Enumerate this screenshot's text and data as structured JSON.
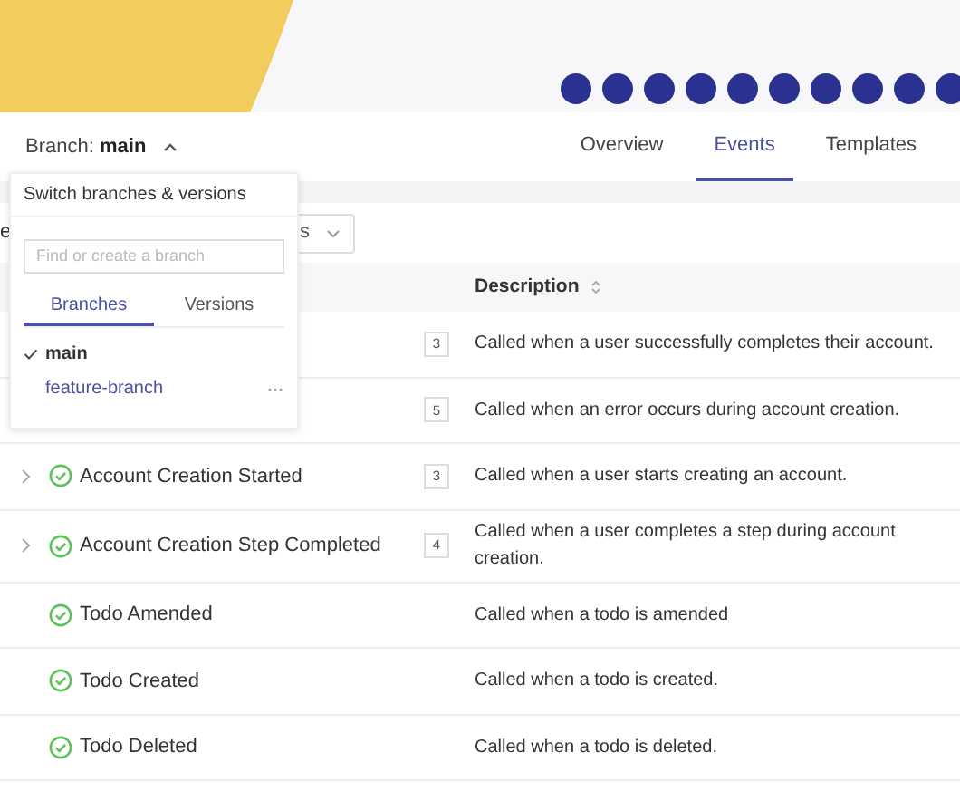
{
  "header": {
    "branch_label": "Branch:",
    "branch_name": "main"
  },
  "tabs": [
    {
      "label": "Overview",
      "selected": false
    },
    {
      "label": "Events",
      "selected": true
    },
    {
      "label": "Templates",
      "selected": false
    }
  ],
  "filters": {
    "left_text": "e",
    "select_text": "s"
  },
  "table": {
    "columns": [
      {
        "label": "Description"
      }
    ],
    "rows": [
      {
        "count": "3",
        "description": "Called when a user successfully completes their account."
      },
      {
        "count": "5",
        "description": "Called when an error occurs during account creation."
      },
      {
        "expandable": true,
        "name": "Account Creation Started",
        "count": "3",
        "description": "Called when a user starts creating an account."
      },
      {
        "expandable": true,
        "name": "Account Creation Step Completed",
        "count": "4",
        "description": "Called when a user completes a step during account creation."
      },
      {
        "expandable": false,
        "name": "Todo Amended",
        "description": "Called when a todo is amended"
      },
      {
        "expandable": false,
        "name": "Todo Created",
        "description": "Called when a todo is created."
      },
      {
        "expandable": false,
        "name": "Todo Deleted",
        "description": "Called when a todo is deleted."
      }
    ]
  },
  "branch_menu": {
    "title": "Switch branches & versions",
    "search": {
      "placeholder": "Find or create a branch"
    },
    "tabs": [
      {
        "label": "Branches",
        "selected": true
      },
      {
        "label": "Versions",
        "selected": false
      }
    ],
    "items": [
      {
        "label": "main",
        "selected": true,
        "more": false
      },
      {
        "label": "feature-branch",
        "selected": false,
        "more": true
      }
    ]
  }
}
